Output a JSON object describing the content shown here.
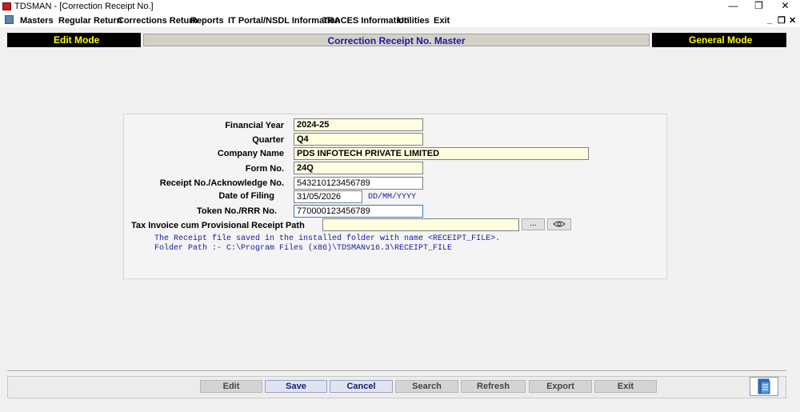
{
  "window": {
    "title": "TDSMAN - [Correction Receipt No.]"
  },
  "menu": [
    "Masters",
    "Regular Return",
    "Corrections Return",
    "Reports",
    "IT Portal/NSDL Information",
    "TRACES Information",
    "Utilities",
    "Exit"
  ],
  "header": {
    "left_mode": "Edit Mode",
    "title": "Correction Receipt No. Master",
    "right_mode": "General Mode"
  },
  "form": {
    "financial_year_label": "Financial Year",
    "financial_year": "2024-25",
    "quarter_label": "Quarter",
    "quarter": "Q4",
    "company_name_label": "Company Name",
    "company_name": "PDS INFOTECH PRIVATE LIMITED",
    "form_no_label": "Form No.",
    "form_no": "24Q",
    "receipt_no_label": "Receipt No./Acknowledge No.",
    "receipt_no": "543210123456789",
    "date_of_filing_label": "Date of Filing",
    "date_of_filing": "31/05/2026",
    "date_format": "DD/MM/YYYY",
    "token_no_label": "Token No./RRR No.",
    "token_no": "770000123456789",
    "receipt_path_label": "Tax Invoice cum Provisional Receipt Path",
    "receipt_path": "",
    "browse_label": "...",
    "note_line1": "The Receipt file saved in the installed folder with name <RECEIPT_FILE>.",
    "note_line2": "Folder Path :- C:\\Program Files (x86)\\TDSMANv16.3\\RECEIPT_FILE"
  },
  "actions": {
    "edit": "Edit",
    "save": "Save",
    "cancel": "Cancel",
    "search": "Search",
    "refresh": "Refresh",
    "export": "Export",
    "exit": "Exit"
  },
  "icons": {
    "app": "tdsman-app-icon",
    "view": "eye-icon",
    "doc": "document-icon"
  }
}
